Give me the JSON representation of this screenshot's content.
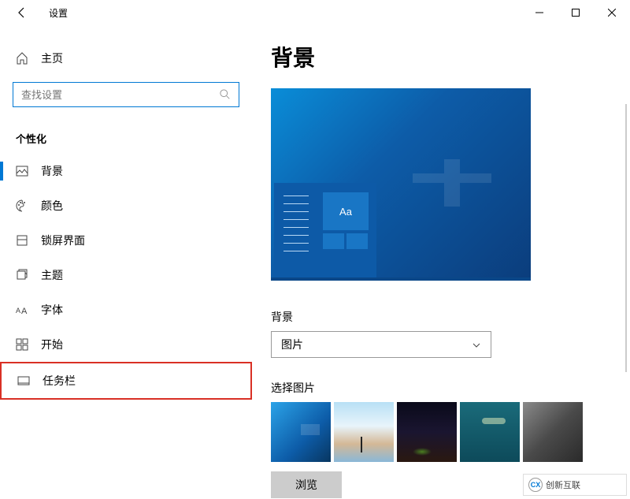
{
  "titlebar": {
    "title": "设置"
  },
  "sidebar": {
    "home_label": "主页",
    "search_placeholder": "查找设置",
    "section_label": "个性化",
    "items": [
      {
        "label": "背景",
        "icon": "image-icon",
        "active": true
      },
      {
        "label": "颜色",
        "icon": "palette-icon"
      },
      {
        "label": "锁屏界面",
        "icon": "lockscreen-icon"
      },
      {
        "label": "主题",
        "icon": "theme-icon"
      },
      {
        "label": "字体",
        "icon": "font-icon"
      },
      {
        "label": "开始",
        "icon": "start-icon"
      },
      {
        "label": "任务栏",
        "icon": "taskbar-icon",
        "highlighted": true
      }
    ]
  },
  "content": {
    "title": "背景",
    "preview_tile_text": "Aa",
    "bg_label": "背景",
    "bg_dropdown_value": "图片",
    "select_pic_label": "选择图片",
    "browse_label": "浏览"
  },
  "watermark": {
    "logo_text": "CX",
    "text": "创新互联"
  }
}
